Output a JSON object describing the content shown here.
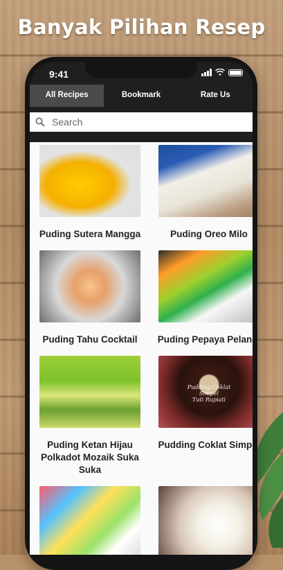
{
  "banner": {
    "title": "Banyak Pilihan Resep"
  },
  "status_bar": {
    "time": "9:41"
  },
  "tabs": [
    {
      "label": "All Recipes",
      "active": true
    },
    {
      "label": "Bookmark",
      "active": false
    },
    {
      "label": "Rate Us",
      "active": false
    }
  ],
  "search": {
    "placeholder": "Search",
    "value": ""
  },
  "recipes": [
    {
      "title": "Puding Sutera Mangga",
      "image_text": ""
    },
    {
      "title": "Puding Oreo Milo",
      "image_text": ""
    },
    {
      "title": "Puding Tahu Cocktail",
      "image_text": ""
    },
    {
      "title": "Puding Pepaya Pelangi",
      "image_text": ""
    },
    {
      "title": "Puding Ketan Hijau Polkadot Mozaik Suka Suka",
      "image_text": ""
    },
    {
      "title": "Pudding Coklat Simpel",
      "image_text": "Pudding Coklat Simpel\nTuti Rupiati"
    },
    {
      "title": "",
      "image_text": ""
    },
    {
      "title": "",
      "image_text": ""
    }
  ],
  "colors": {
    "tab_bar": "#1f1f1f",
    "active_tab": "#4a4a4a",
    "accent_text": "#ffffff"
  },
  "icons": {
    "search": "search-icon",
    "signal": "signal-icon",
    "wifi": "wifi-icon",
    "battery": "battery-icon"
  }
}
